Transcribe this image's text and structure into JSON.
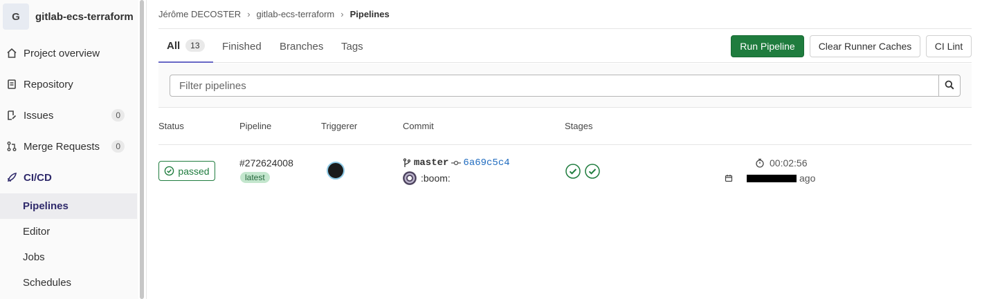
{
  "sidebar": {
    "project_initial": "G",
    "project_name": "gitlab-ecs-terraform",
    "items": [
      {
        "label": "Project overview"
      },
      {
        "label": "Repository"
      },
      {
        "label": "Issues",
        "count": "0"
      },
      {
        "label": "Merge Requests",
        "count": "0"
      },
      {
        "label": "CI/CD"
      }
    ],
    "sub_items": [
      {
        "label": "Pipelines"
      },
      {
        "label": "Editor"
      },
      {
        "label": "Jobs"
      },
      {
        "label": "Schedules"
      }
    ]
  },
  "breadcrumb": {
    "user": "Jérôme DECOSTER",
    "project": "gitlab-ecs-terraform",
    "current": "Pipelines"
  },
  "tabs": {
    "all": "All",
    "all_count": "13",
    "finished": "Finished",
    "branches": "Branches",
    "tags": "Tags"
  },
  "actions": {
    "run_pipeline": "Run Pipeline",
    "clear_caches": "Clear Runner Caches",
    "ci_lint": "CI Lint"
  },
  "filter": {
    "placeholder": "Filter pipelines"
  },
  "table": {
    "headers": {
      "status": "Status",
      "pipeline": "Pipeline",
      "triggerer": "Triggerer",
      "commit": "Commit",
      "stages": "Stages"
    },
    "rows": [
      {
        "status": "passed",
        "pipeline_id": "#272624008",
        "badge": "latest",
        "ref": "master",
        "sha": "6a69c5c4",
        "message": ":boom:",
        "duration": "00:02:56",
        "finished_suffix": "ago"
      }
    ]
  },
  "colors": {
    "success": "#1f7c3e",
    "link": "#1f6bbf",
    "active_nav": "#2f2a6b"
  }
}
